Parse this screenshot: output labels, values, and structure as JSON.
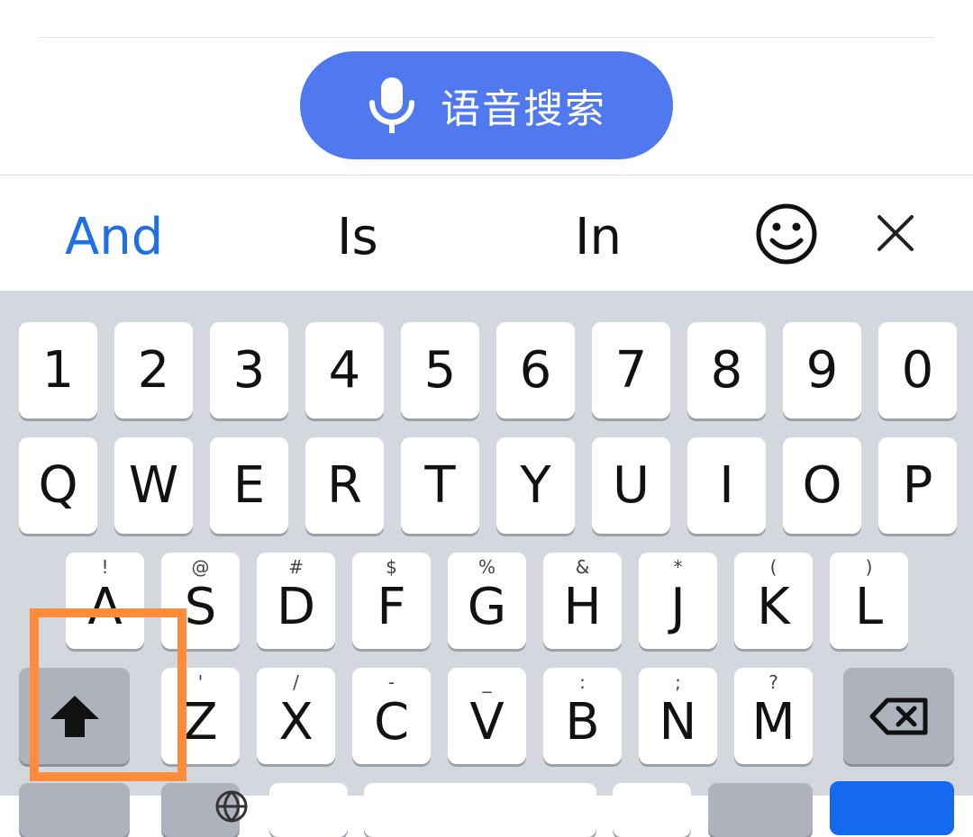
{
  "search": {
    "voice_label": "语音搜索"
  },
  "suggestions": [
    "And",
    "Is",
    "In"
  ],
  "icons": {
    "mic": "microphone-icon",
    "emoji": "smiley-icon",
    "close": "close-icon",
    "shift": "shift-arrow-icon",
    "backspace": "backspace-icon",
    "globe": "globe-icon"
  },
  "keyboard": {
    "number_row": [
      "1",
      "2",
      "3",
      "4",
      "5",
      "6",
      "7",
      "8",
      "9",
      "0"
    ],
    "row_q": [
      "Q",
      "W",
      "E",
      "R",
      "T",
      "Y",
      "U",
      "I",
      "O",
      "P"
    ],
    "row_a": [
      {
        "main": "A",
        "sub": "!"
      },
      {
        "main": "S",
        "sub": "@"
      },
      {
        "main": "D",
        "sub": "#"
      },
      {
        "main": "F",
        "sub": "$"
      },
      {
        "main": "G",
        "sub": "%"
      },
      {
        "main": "H",
        "sub": "&"
      },
      {
        "main": "J",
        "sub": "*"
      },
      {
        "main": "K",
        "sub": "("
      },
      {
        "main": "L",
        "sub": ")"
      }
    ],
    "row_z": [
      {
        "main": "Z",
        "sub": "'"
      },
      {
        "main": "X",
        "sub": "/"
      },
      {
        "main": "C",
        "sub": "-"
      },
      {
        "main": "V",
        "sub": "_"
      },
      {
        "main": "B",
        "sub": ":"
      },
      {
        "main": "N",
        "sub": ";"
      },
      {
        "main": "M",
        "sub": "?"
      }
    ]
  },
  "colors": {
    "accent": "#5078ef",
    "suggestion_primary": "#1f6fe6",
    "highlight": "#ff8c3a",
    "keyboard_bg": "#d5d7de"
  }
}
